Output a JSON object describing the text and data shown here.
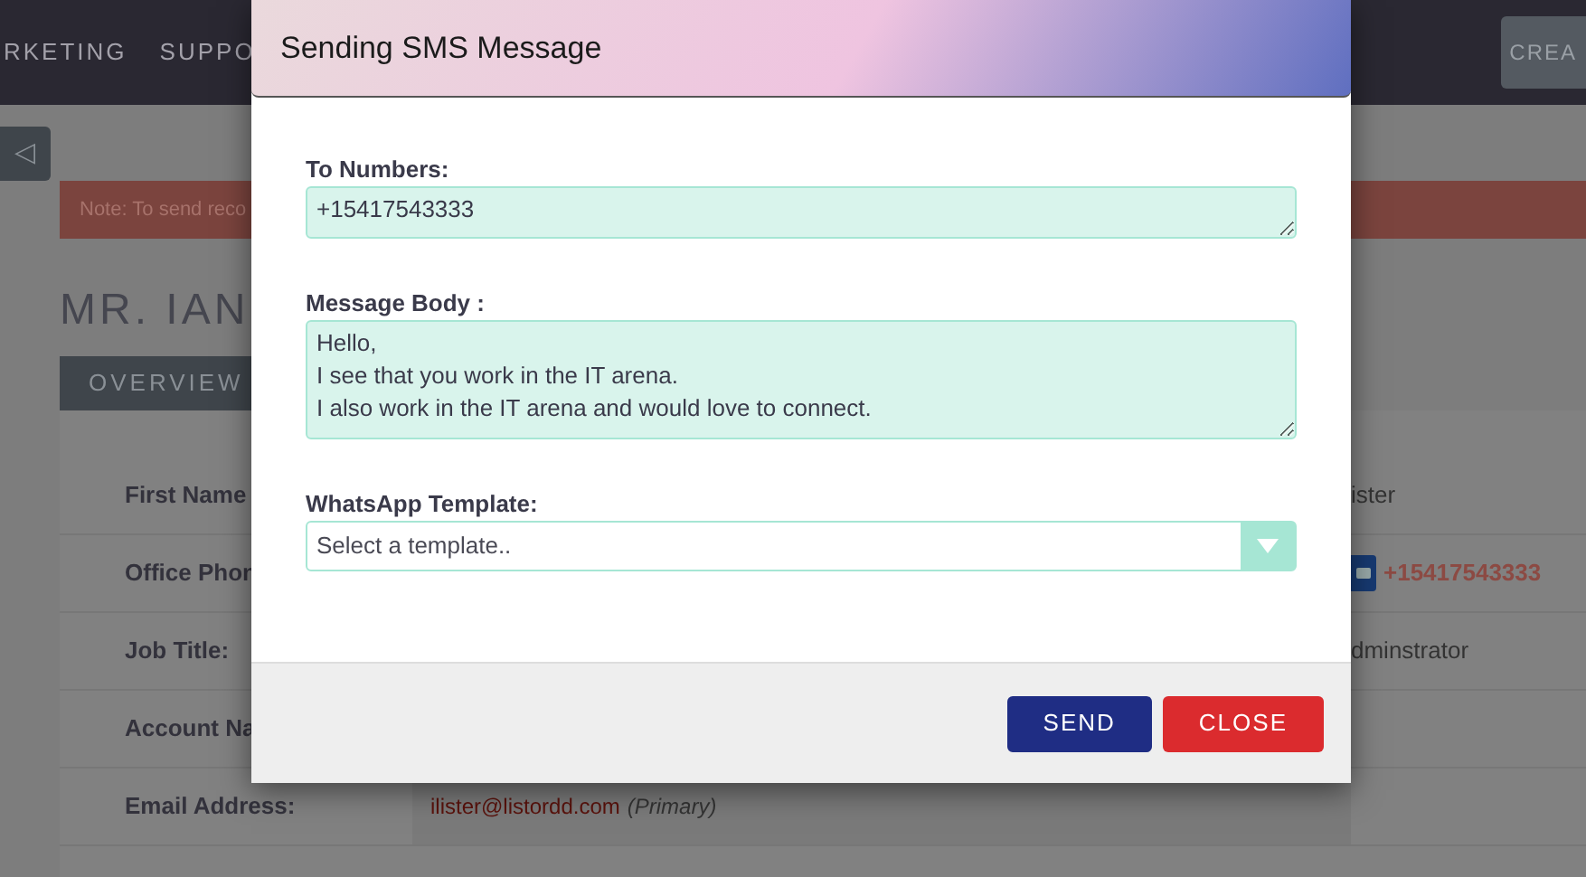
{
  "nav": {
    "items": [
      "RKETING",
      "SUPPO"
    ],
    "create_button": "CREA"
  },
  "back_button": "◁",
  "note": "Note: To send reco",
  "title": "MR. IAN",
  "tabs": [
    {
      "label": "OVERVIEW",
      "selected": true
    }
  ],
  "rows": [
    {
      "label": "First Name",
      "right_value": "ister"
    },
    {
      "label": "Office Phon",
      "right_value": "+15417543333",
      "kind": "phone"
    },
    {
      "label": "Job Title:",
      "right_value": "dminstrator"
    },
    {
      "label": "Account Na"
    },
    {
      "label": "Email Address:",
      "value": "ilister@listordd.com",
      "value_note": "(Primary)"
    }
  ],
  "modal": {
    "title": "Sending SMS Message",
    "fields": [
      {
        "kind": "textarea",
        "label": "To Numbers:",
        "value": "+15417543333"
      },
      {
        "kind": "textarea",
        "label": "Message Body :",
        "value": "Hello,\nI see that you work in the IT arena.\nI also work in the IT arena and would love to connect."
      },
      {
        "kind": "select",
        "label": "WhatsApp Template:",
        "placeholder": "Select a template.."
      }
    ],
    "buttons": [
      {
        "label": "SEND",
        "kind": "primary"
      },
      {
        "label": "CLOSE",
        "kind": "danger"
      }
    ]
  }
}
